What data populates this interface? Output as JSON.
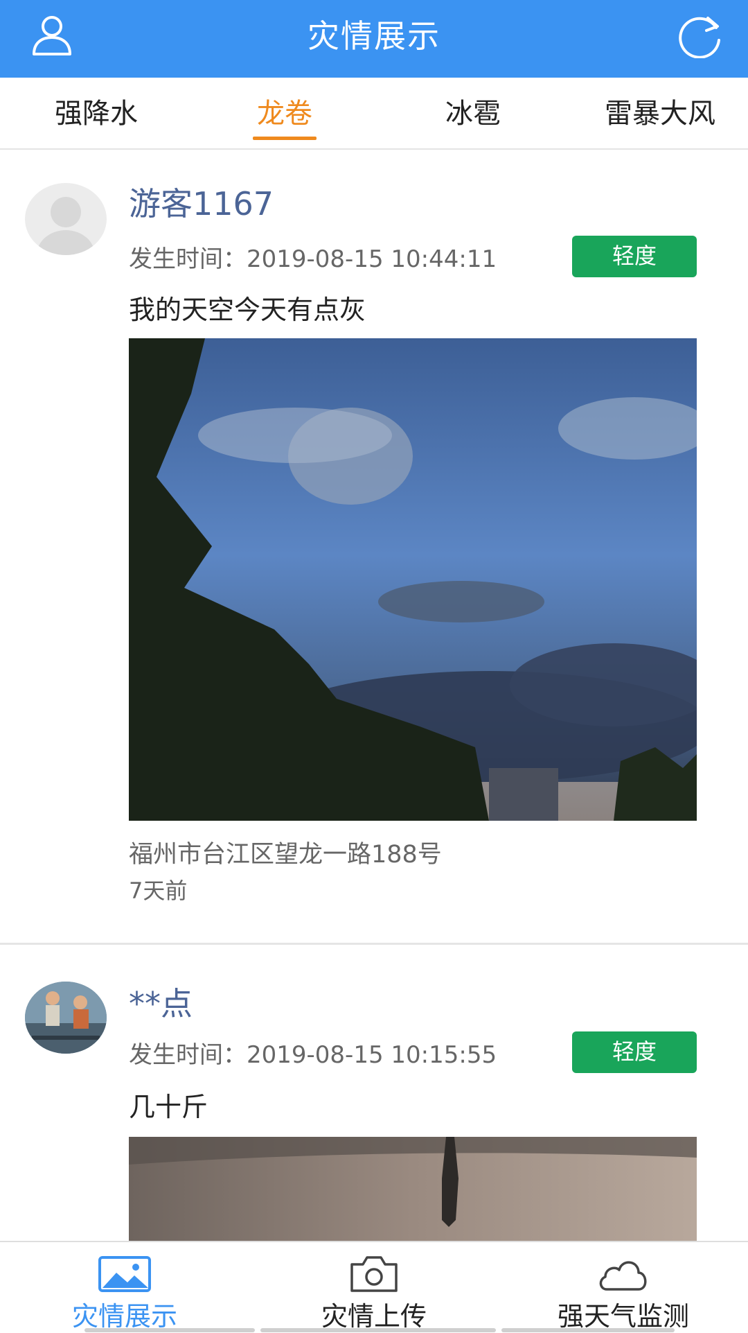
{
  "header": {
    "title": "灾情展示",
    "left_icon": "user-icon",
    "right_icon": "refresh-icon",
    "color": "#3b93f2"
  },
  "tabs": [
    {
      "label": "强降水",
      "active": false
    },
    {
      "label": "龙卷",
      "active": true
    },
    {
      "label": "冰雹",
      "active": false
    },
    {
      "label": "雷暴大风",
      "active": false
    }
  ],
  "accent_color": "#ef8a1e",
  "posts": [
    {
      "username": "游客1167",
      "time": "发生时间：2019-08-15 10:44:11",
      "severity": "轻度",
      "content": "我的天空今天有点灰",
      "address": "福州市台江区望龙一路188号",
      "ago": "7天前"
    },
    {
      "username": "**点",
      "time": "发生时间：2019-08-15 10:15:55",
      "severity": "轻度",
      "content": "几十斤"
    }
  ],
  "severity_color": "#19a55a",
  "bottom_nav": [
    {
      "label": "灾情展示",
      "icon": "picture-icon",
      "active": true
    },
    {
      "label": "灾情上传",
      "icon": "camera-icon",
      "active": false
    },
    {
      "label": "强天气监测",
      "icon": "cloud-icon",
      "active": false
    }
  ]
}
